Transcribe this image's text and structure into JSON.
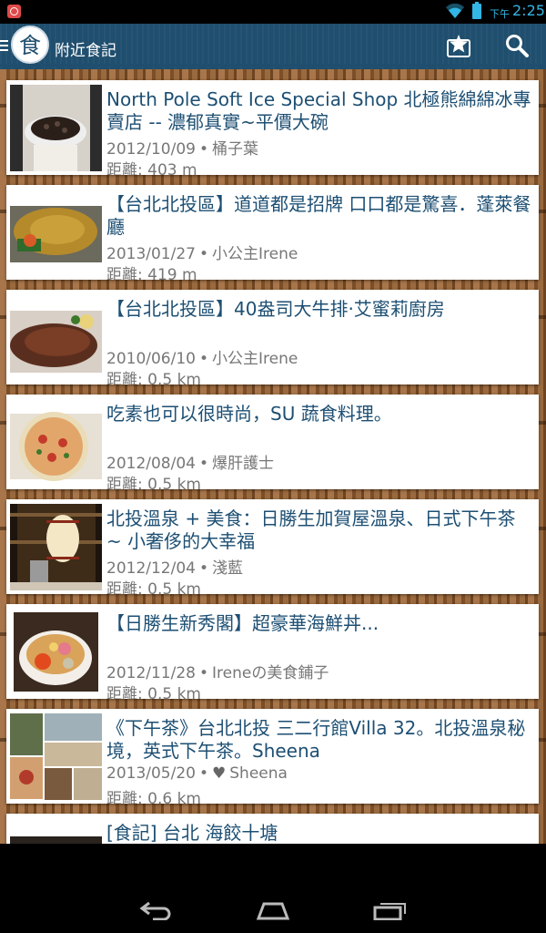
{
  "status_bar": {
    "ampm": "下午",
    "time": "2:25"
  },
  "action_bar": {
    "logo_char": "食",
    "title": "附近食記"
  },
  "posts": [
    {
      "title": "North Pole Soft Ice Special Shop 北極熊綿綿冰專賣店 -- 濃郁真實~平價大碗",
      "date": "2012/10/09",
      "author": "桶子葉",
      "distance": "距離: 403 m"
    },
    {
      "title": "【台北北投區】道道都是招牌 口口都是驚喜．蓬萊餐廳",
      "date": "2013/01/27",
      "author": "小公主Irene",
      "distance": "距離: 419 m"
    },
    {
      "title": "【台北北投區】40盎司大牛排‧艾蜜莉廚房",
      "date": "2010/06/10",
      "author": "小公主Irene",
      "distance": "距離: 0.5 km"
    },
    {
      "title": "吃素也可以很時尚，SU 蔬食料理。",
      "date": "2012/08/04",
      "author": "爆肝護士",
      "distance": "距離: 0.5 km"
    },
    {
      "title": "北投溫泉 + 美食：日勝生加賀屋溫泉、日式下午茶 ~ 小奢侈的大幸福",
      "date": "2012/12/04",
      "author": "淺藍",
      "distance": "距離: 0.5 km"
    },
    {
      "title": "【日勝生新秀閣】超豪華海鮮丼...",
      "date": "2012/11/28",
      "author": "Ireneの美食鋪子",
      "distance": "距離: 0.5 km"
    },
    {
      "title": "《下午茶》台北北投 三二行館Villa 32。北投溫泉秘境，英式下午茶。Sheena",
      "date": "2013/05/20",
      "author": "Sheena",
      "distance": "距離: 0.6 km"
    },
    {
      "title": "[食記] 台北 海餃十塘",
      "date": "",
      "author": "",
      "distance": ""
    }
  ],
  "icons": {
    "menu": "menu-icon",
    "star": "star-icon",
    "search": "search-icon",
    "back": "back-icon",
    "home": "home-icon",
    "recents": "recents-icon",
    "heart": "heart-icon"
  },
  "colors": {
    "action_bar": "#1f4e6e",
    "title_text": "#1d4f73",
    "status_accent": "#33b5e5"
  }
}
